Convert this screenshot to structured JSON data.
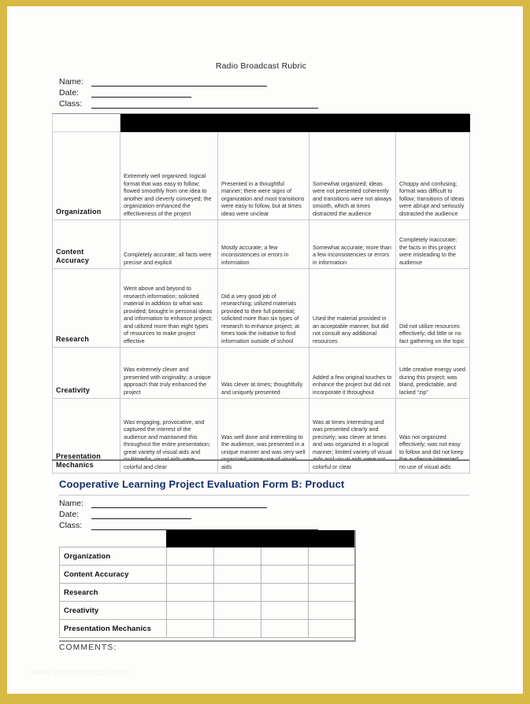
{
  "document": {
    "title": "Radio Broadcast Rubric",
    "comments_label": "COMMENTS:",
    "watermark": "www.templatesdoc.com",
    "accent_border_color": "#d8b943",
    "heading_color": "#16306b",
    "header_cell_color": "#000000"
  },
  "form_a": {
    "fields": [
      {
        "label": "Name:"
      },
      {
        "label": "Date:"
      },
      {
        "label": "Class:"
      }
    ]
  },
  "rubric": {
    "criteria_header": "",
    "level_headers": [
      "",
      "",
      "",
      ""
    ],
    "rows": [
      {
        "criterion": "Organization",
        "levels": [
          "Extremely well organized; logical format that was easy to follow; flowed smoothly from one idea to another and cleverly conveyed; the organization enhanced the effectiveness of the project",
          "Presented in a thoughtful manner; there were signs of organization and most transitions were easy to follow, but at times ideas were unclear",
          "Somewhat organized; ideas were not presented coherently and transitions were not always smooth, which at times distracted the audience",
          "Choppy and confusing; format was difficult to follow; transitions of ideas were abrupt and seriously distracted the audience"
        ]
      },
      {
        "criterion": "Content Accuracy",
        "levels": [
          "Completely accurate; all facts were precise and explicit",
          "Mostly accurate; a few inconsistencies or errors in information",
          "Somewhat accurate; more than a few inconsistencies or errors in information",
          "Completely inaccurate; the facts in this project were misleading to the audience"
        ]
      },
      {
        "criterion": "Research",
        "levels": [
          "Went above and beyond to research information; solicited material in addition to what was provided; brought in personal ideas and information to enhance project; and utilized more than eight types of resources to make project effective",
          "Did a very good job of researching; utilized materials provided to their full potential; solicited more than six types of research to enhance project; at times took the initiative to find information outside of school",
          "Used the material provided in an acceptable manner, but did not consult any additional resources",
          "Did not utilize resources effectively; did little or no fact gathering on the topic"
        ]
      },
      {
        "criterion": "Creativity",
        "levels": [
          "Was extremely clever and presented with originality; a unique approach that truly enhanced the project",
          "Was clever at times; thoughtfully and uniquely presented",
          "Added a few original touches to enhance the project but did not incorporate it throughout",
          "Little creative energy used during this project; was bland, predictable, and lacked “zip”"
        ]
      },
      {
        "criterion": "Presentation Mechanics",
        "levels": [
          "Was engaging, provocative, and captured the interest of the audience and maintained this throughout the entire presentation; great variety of visual aids and multimedia; visual aids were colorful and clear",
          "Was well done and interesting to the audience, was presented in a unique manner and was very well organized; some use of visual aids",
          "Was at times interesting and was presented clearly and precisely; was clever at times and was organized in a logical manner; limited variety of visual aids and visual aids were not colorful or clear",
          "Was not organized effectively; was not easy to follow and did not keep the audience interested; no use of visual aids"
        ]
      }
    ]
  },
  "section_b": {
    "heading": "Cooperative Learning Project Evaluation Form B: Product",
    "fields": [
      {
        "label": "Name:"
      },
      {
        "label": "Date:"
      },
      {
        "label": "Class:"
      }
    ],
    "grid": {
      "column_headers": [
        "",
        "",
        "",
        ""
      ],
      "rows": [
        {
          "criterion": "Organization",
          "marks": [
            "",
            "",
            "",
            ""
          ]
        },
        {
          "criterion": "Content Accuracy",
          "marks": [
            "",
            "",
            "",
            ""
          ]
        },
        {
          "criterion": "Research",
          "marks": [
            "",
            "",
            "",
            ""
          ]
        },
        {
          "criterion": "Creativity",
          "marks": [
            "",
            "",
            "",
            ""
          ]
        },
        {
          "criterion": "Presentation Mechanics",
          "marks": [
            "",
            "",
            "",
            ""
          ]
        }
      ]
    }
  }
}
